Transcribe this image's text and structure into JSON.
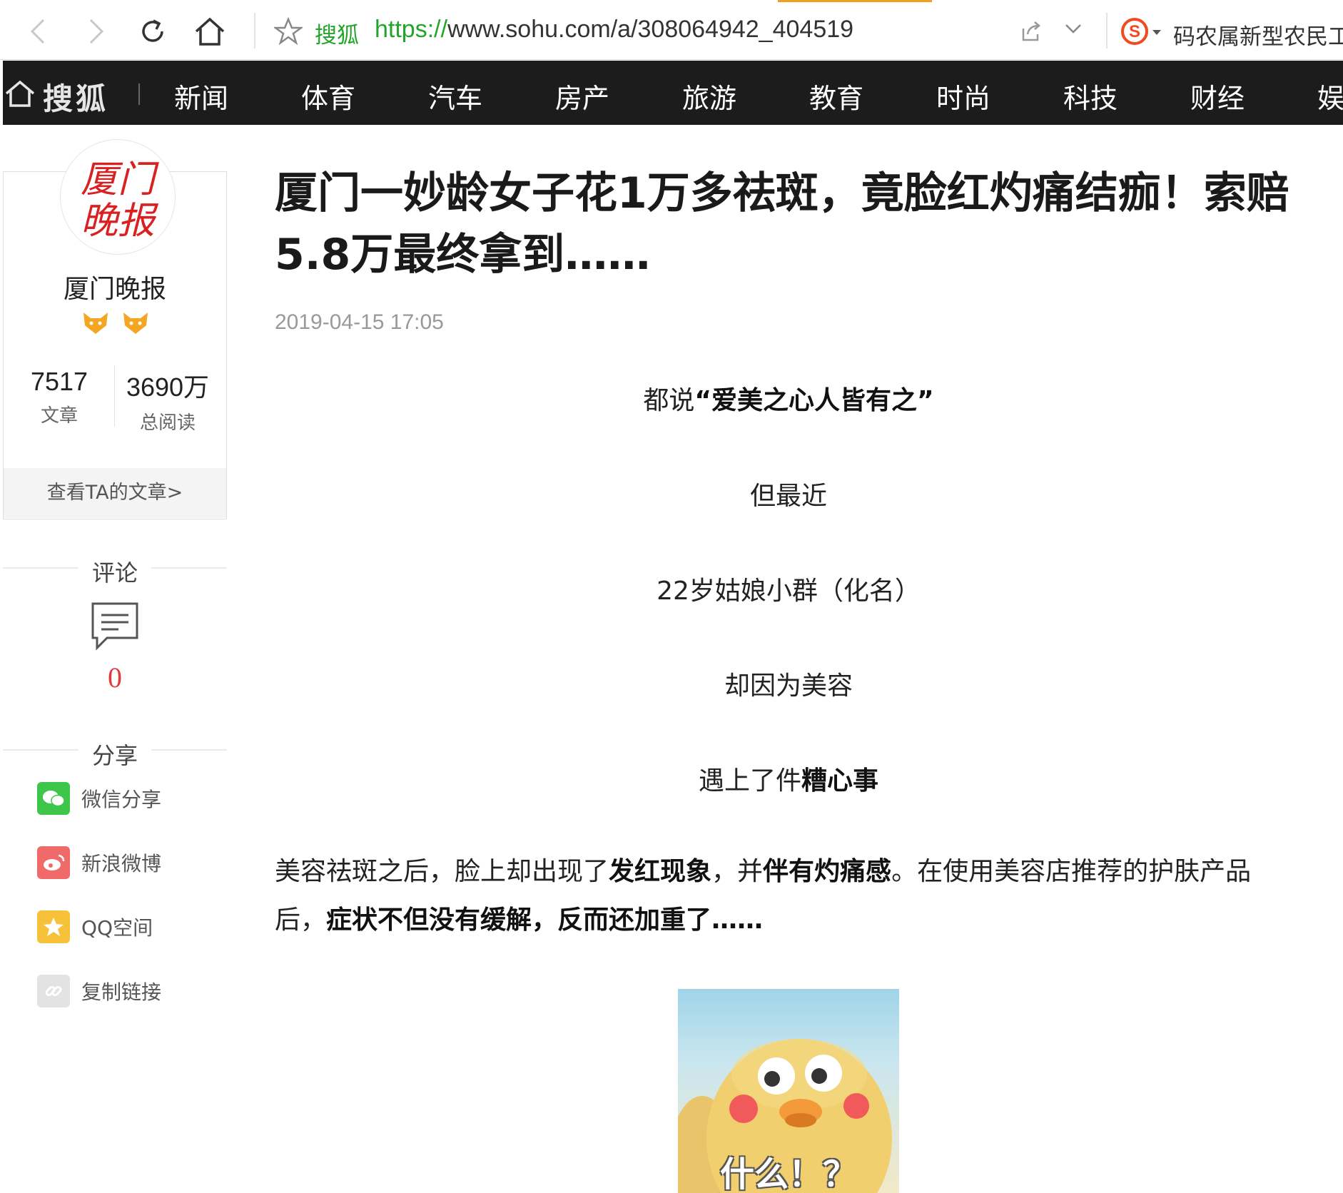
{
  "browser": {
    "site_name": "搜狐",
    "url_scheme": "https://",
    "url_rest": "www.sohu.com/a/308064942_404519",
    "user_name": "码农属新型农民工",
    "icons": [
      "back-icon",
      "forward-icon",
      "refresh-icon",
      "home-icon",
      "star-icon",
      "share-icon",
      "chevron-down-icon",
      "sogou-icon"
    ]
  },
  "nav": {
    "logo": "搜狐",
    "items": [
      "新闻",
      "体育",
      "汽车",
      "房产",
      "旅游",
      "教育",
      "时尚",
      "科技",
      "财经",
      "娱"
    ]
  },
  "author": {
    "avatar_text": [
      "厦门",
      "晚报"
    ],
    "name": "厦门晚报",
    "articles_count": "7517",
    "articles_label": "文章",
    "reads_count": "3690万",
    "reads_label": "总阅读",
    "view_articles": "查看TA的文章>"
  },
  "comments": {
    "title": "评论",
    "count": "0"
  },
  "share": {
    "title": "分享",
    "items": [
      {
        "label": "微信分享",
        "icon": "wechat-icon",
        "color": "#3dc64a"
      },
      {
        "label": "新浪微博",
        "icon": "weibo-icon",
        "color": "#f06a6a"
      },
      {
        "label": "QQ空间",
        "icon": "qzone-icon",
        "color": "#f7c23a"
      },
      {
        "label": "复制链接",
        "icon": "link-icon",
        "color": "#d8d8d8"
      }
    ]
  },
  "article": {
    "title": "厦门一妙龄女子花1万多祛斑，竟脸红灼痛结痂！索赔5.8万最终拿到……",
    "time": "2019-04-15 17:05",
    "p1_pre": "都说",
    "p1_bold": "“爱美之心人皆有之”",
    "p2": "但最近",
    "p3": "22岁姑娘小群（化名）",
    "p4": "却因为美容",
    "p5_pre": "遇上了件",
    "p5_bold": "糟心事",
    "body_1": "美容祛斑之后，脸上却出现了",
    "body_2": "发红现象",
    "body_3": "，并",
    "body_4": "伴有灼痛感",
    "body_5": "。在使用美容店推荐的护肤产品后，",
    "body_6": "症状不但没有缓解，反而还加重了……",
    "meme_caption": "什么！？"
  },
  "colors": {
    "nav_bg": "#1c1c1c",
    "accent_green": "#22a52a",
    "comment_red": "#e4393c",
    "logo_red": "#d92121"
  }
}
